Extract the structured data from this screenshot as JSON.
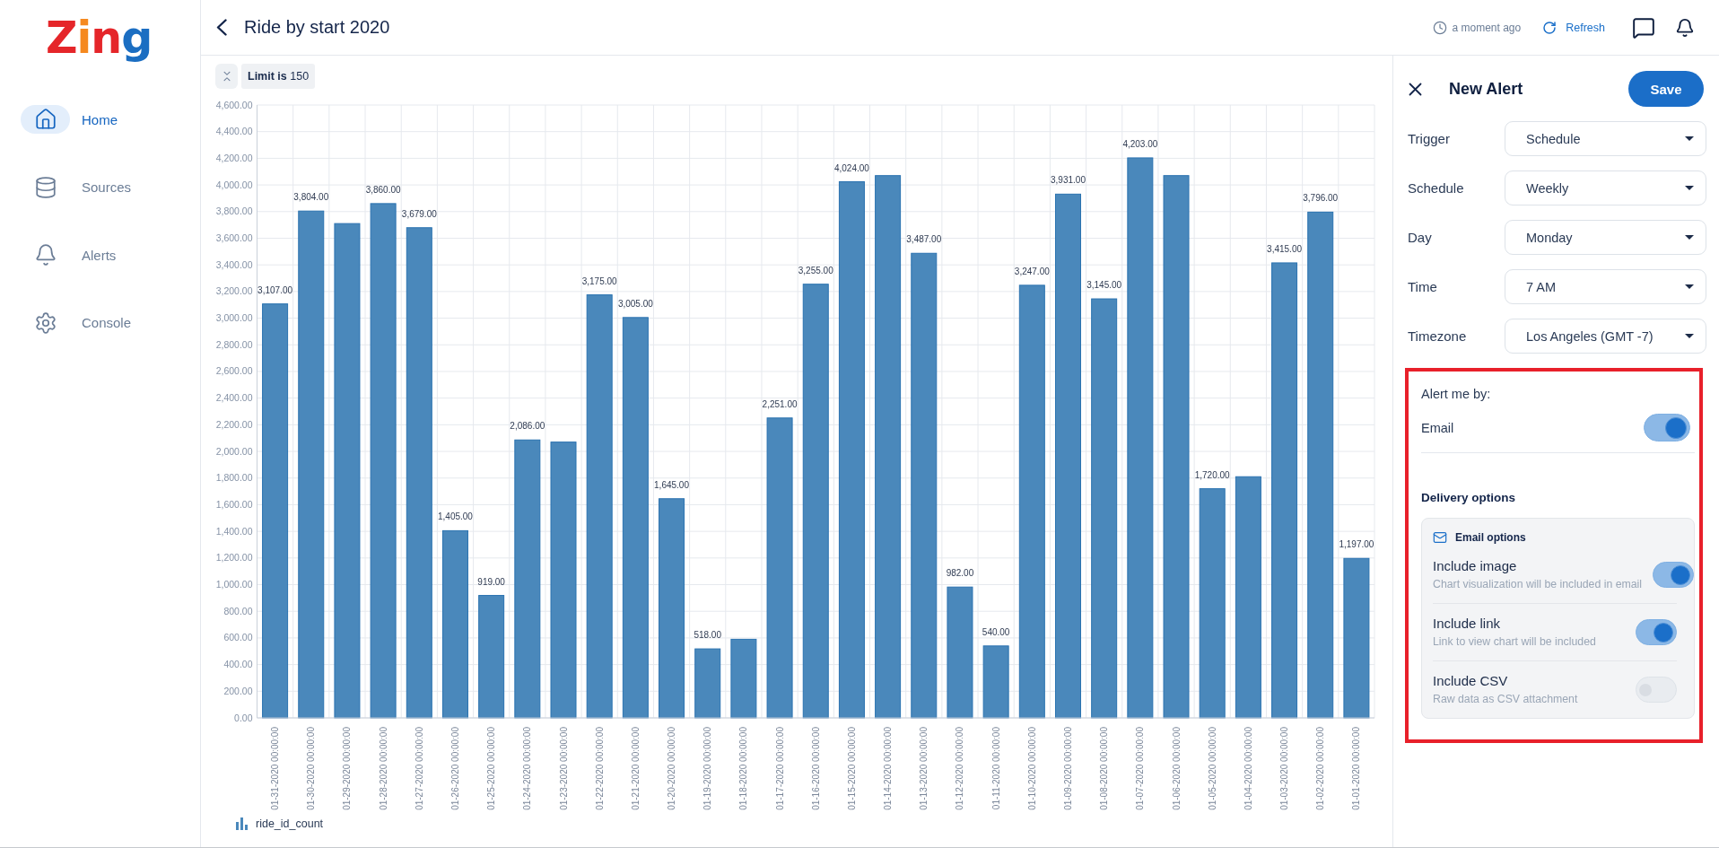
{
  "sidebar": {
    "logo": "Zing",
    "items": [
      {
        "label": "Home",
        "selected": true
      },
      {
        "label": "Sources",
        "selected": false
      },
      {
        "label": "Alerts",
        "selected": false
      },
      {
        "label": "Console",
        "selected": false
      }
    ]
  },
  "header": {
    "title": "Ride by start 2020",
    "updated": "a moment ago",
    "refresh_label": "Refresh"
  },
  "toolbar": {
    "limit": "**Limit is** 150"
  },
  "chart": {
    "chart_data": {
      "type": "bar",
      "grid": true,
      "categories": [
        "01-31-2020 00:00:00",
        "01-30-2020 00:00:00",
        "01-29-2020 00:00:00",
        "01-28-2020 00:00:00",
        "01-27-2020 00:00:00",
        "01-26-2020 00:00:00",
        "01-25-2020 00:00:00",
        "01-24-2020 00:00:00",
        "01-23-2020 00:00:00",
        "01-22-2020 00:00:00",
        "01-21-2020 00:00:00",
        "01-20-2020 00:00:00",
        "01-19-2020 00:00:00",
        "01-18-2020 00:00:00",
        "01-17-2020 00:00:00",
        "01-16-2020 00:00:00",
        "01-15-2020 00:00:00",
        "01-14-2020 00:00:00",
        "01-13-2020 00:00:00",
        "01-12-2020 00:00:00",
        "01-11-2020 00:00:00",
        "01-10-2020 00:00:00",
        "01-09-2020 00:00:00",
        "01-08-2020 00:00:00",
        "01-07-2020 00:00:00",
        "01-06-2020 00:00:00",
        "01-05-2020 00:00:00",
        "01-04-2020 00:00:00",
        "01-03-2020 00:00:00",
        "01-02-2020 00:00:00",
        "01-01-2020 00:00:00"
      ],
      "series": [
        {
          "name": "ride_id_count",
          "color": "#4a88bb",
          "values": [
            3107,
            3804,
            3710,
            3860,
            3679,
            1405,
            919,
            2086,
            2070,
            3175,
            3005,
            1645,
            518,
            590,
            2251,
            3255,
            4024,
            4070,
            3487,
            982,
            540,
            3247,
            3931,
            3145,
            4203,
            4070,
            1720,
            1810,
            3415,
            3796,
            1197
          ]
        }
      ],
      "ylim": [
        0,
        4600
      ],
      "yticks": [
        {
          "value": 0,
          "label": "0.00"
        },
        {
          "value": 200,
          "label": "200.00"
        },
        {
          "value": 400,
          "label": "400.00"
        },
        {
          "value": 600,
          "label": "600.00"
        },
        {
          "value": 800,
          "label": "800.00"
        },
        {
          "value": 1000,
          "label": "1,000.00"
        },
        {
          "value": 1200,
          "label": "1,200.00"
        },
        {
          "value": 1400,
          "label": "1,400.00"
        },
        {
          "value": 1600,
          "label": "1,600.00"
        },
        {
          "value": 1800,
          "label": "1,800.00"
        },
        {
          "value": 2000,
          "label": "2,000.00"
        },
        {
          "value": 2200,
          "label": "2,200.00"
        },
        {
          "value": 2400,
          "label": "2,400.00"
        },
        {
          "value": 2600,
          "label": "2,600.00"
        },
        {
          "value": 2800,
          "label": "2,800.00"
        },
        {
          "value": 3000,
          "label": "3,000.00"
        },
        {
          "value": 3200,
          "label": "3,200.00"
        },
        {
          "value": 3400,
          "label": "3,400.00"
        },
        {
          "value": 3600,
          "label": "3,600.00"
        },
        {
          "value": 3800,
          "label": "3,800.00"
        },
        {
          "value": 4000,
          "label": "4,000.00"
        },
        {
          "value": 4200,
          "label": "4,200.00"
        },
        {
          "value": 4400,
          "label": "4,400.00"
        },
        {
          "value": 4600,
          "label": "4,600.00"
        }
      ],
      "value_labels": [
        "3,107.00",
        "3,804.00",
        null,
        "3,860.00",
        "3,679.00",
        "1,405.00",
        "919.00",
        "2,086.00",
        null,
        "3,175.00",
        "3,005.00",
        "1,645.00",
        "518.00",
        null,
        "2,251.00",
        "3,255.00",
        "4,024.00",
        null,
        "3,487.00",
        "982.00",
        "540.00",
        "3,247.00",
        "3,931.00",
        "3,145.00",
        "4,203.00",
        null,
        "1,720.00",
        null,
        "3,415.00",
        "3,796.00",
        "1,197.00"
      ]
    }
  },
  "alert_panel": {
    "title": "New Alert",
    "save_label": "Save",
    "fields": [
      {
        "label": "Trigger",
        "value": "Schedule"
      },
      {
        "label": "Schedule",
        "value": "Weekly"
      },
      {
        "label": "Day",
        "value": "Monday"
      },
      {
        "label": "Time",
        "value": "7 AM"
      },
      {
        "label": "Timezone",
        "value": "Los Angeles (GMT -7)"
      }
    ],
    "notifications": {
      "highlighted": true,
      "label": "Alert me by:",
      "channels": [
        {
          "label": "Email",
          "on": true
        }
      ],
      "delivery_title": "Delivery options",
      "card_title": "Email options",
      "options": [
        {
          "label": "Include image",
          "description": "Chart visualization will be included in email",
          "on": true
        },
        {
          "label": "Include link",
          "description": "Link to view chart will be included",
          "on": true
        },
        {
          "label": "Include CSV",
          "description": "Raw data as CSV attachment",
          "on": false
        }
      ]
    }
  }
}
